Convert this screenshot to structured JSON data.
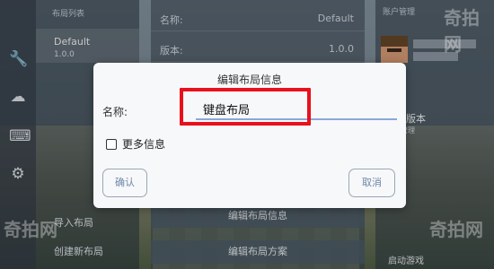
{
  "left_panel": {
    "header": "布局列表",
    "selected_item": {
      "name": "Default",
      "version": "1.0.0"
    },
    "import_label": "导入布局",
    "create_label": "创建新布局"
  },
  "rail_icons": [
    "wrench-icon",
    "cloud-download-icon",
    "keyboard-icon",
    "gear-icon"
  ],
  "center_panel": {
    "rows": [
      {
        "key": "名称:",
        "value": "Default"
      },
      {
        "key": "版本:",
        "value": "1.0.0"
      }
    ],
    "edit_info_label": "编辑布局信息",
    "edit_scheme_label": "编辑布局方案"
  },
  "right_panel": {
    "header": "账户管理",
    "no_version": "没有版本",
    "tap_manage": "点击管理",
    "launch_label": "启动游戏"
  },
  "dialog": {
    "title": "编辑布局信息",
    "name_label": "名称:",
    "name_value": "键盘布局",
    "more_info_label": "更多信息",
    "more_info_checked": false,
    "confirm_label": "确认",
    "cancel_label": "取消",
    "highlight_color": "#e8111b"
  },
  "watermark": "奇拍网"
}
